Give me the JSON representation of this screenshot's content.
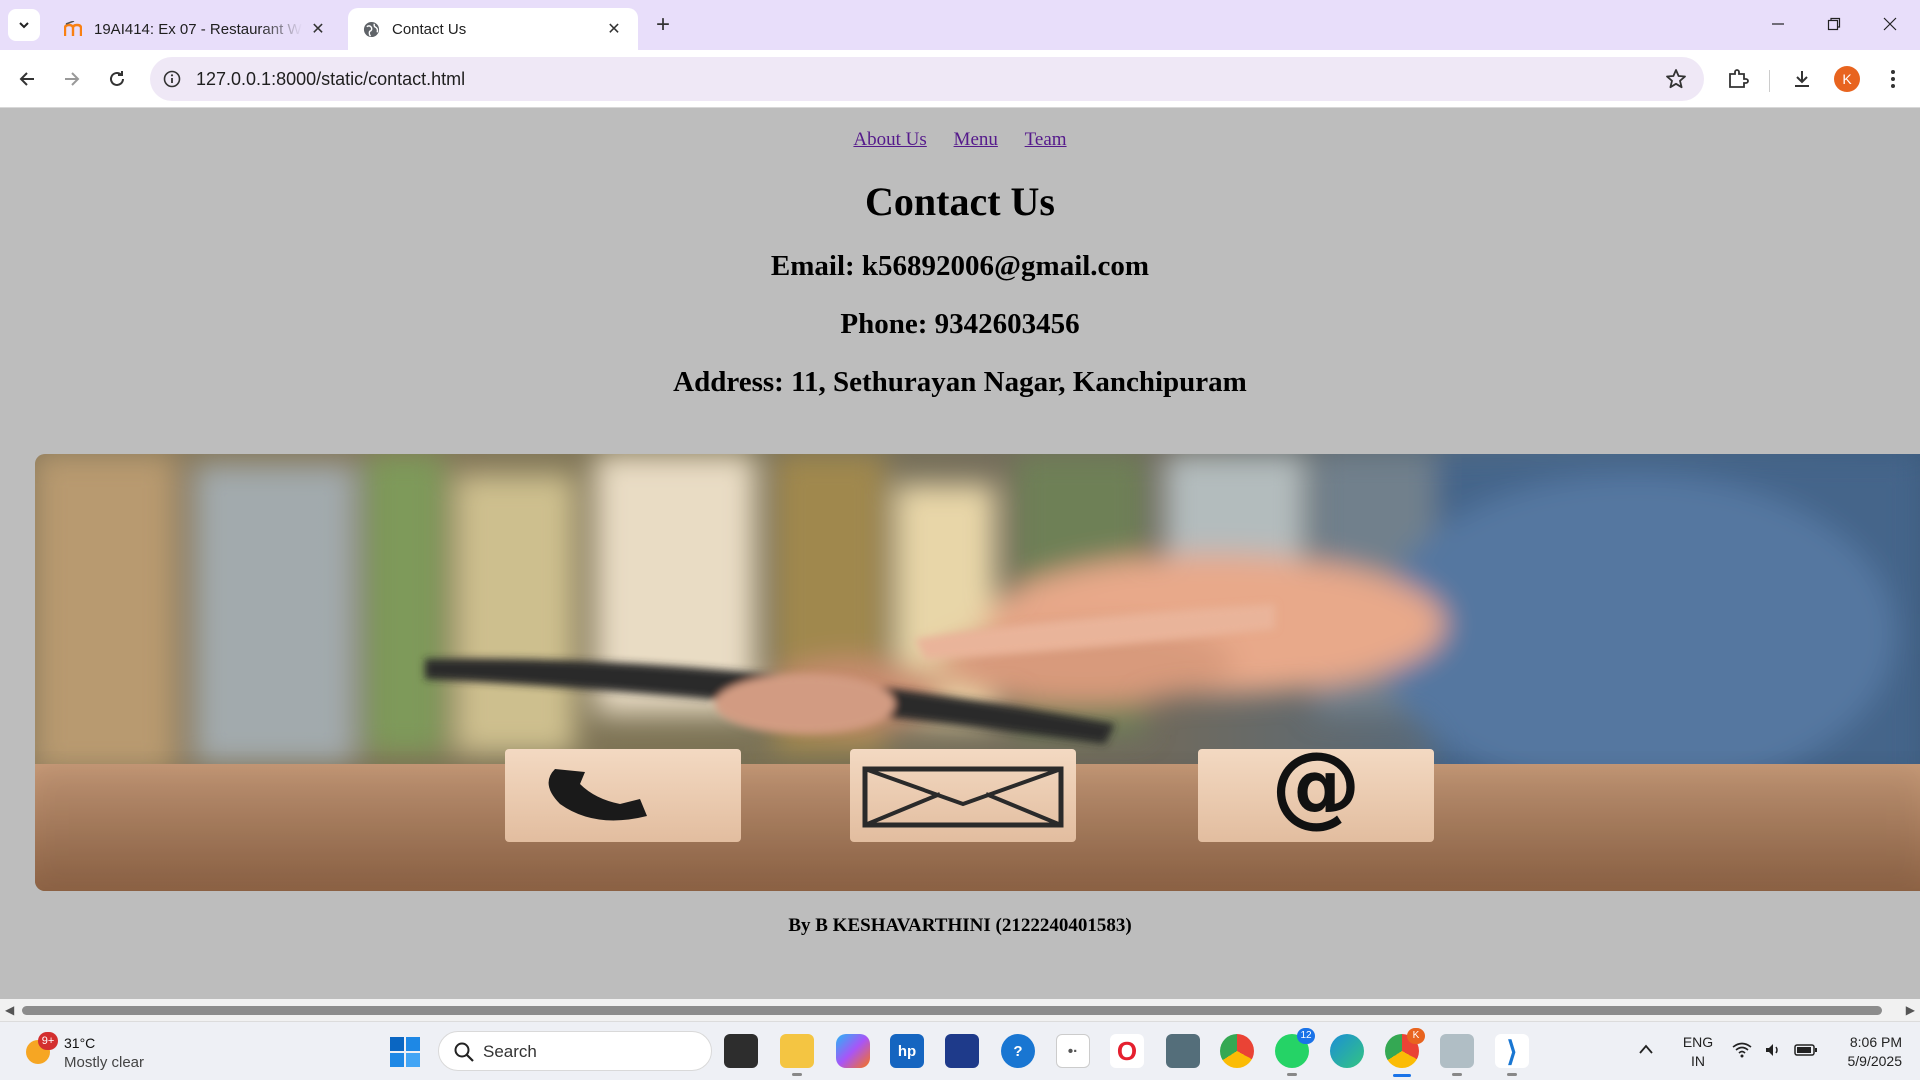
{
  "browser": {
    "tabs": [
      {
        "title": "19AI414: Ex 07 - Restaurant We",
        "active": false,
        "icon": "moodle-favicon"
      },
      {
        "title": "Contact Us",
        "active": true,
        "icon": "globe-favicon"
      }
    ],
    "url": "127.0.0.1:8000/static/contact.html",
    "profile_initial": "K"
  },
  "page": {
    "nav": [
      "About Us",
      "Menu",
      "Team"
    ],
    "heading": "Contact Us",
    "email": "Email: k56892006@gmail.com",
    "phone": "Phone: 9342603456",
    "address": "Address: 11, Sethurayan Nagar, Kanchipuram",
    "footer": "By B KESHAVARTHINI (2122240401583)"
  },
  "taskbar": {
    "weather": {
      "temp": "31°C",
      "condition": "Mostly clear",
      "badge": "9+"
    },
    "search_placeholder": "Search",
    "whatsapp_badge": "12",
    "chrome_badge": "K",
    "language": {
      "line1": "ENG",
      "line2": "IN"
    },
    "time": "8:06 PM",
    "date": "5/9/2025"
  }
}
